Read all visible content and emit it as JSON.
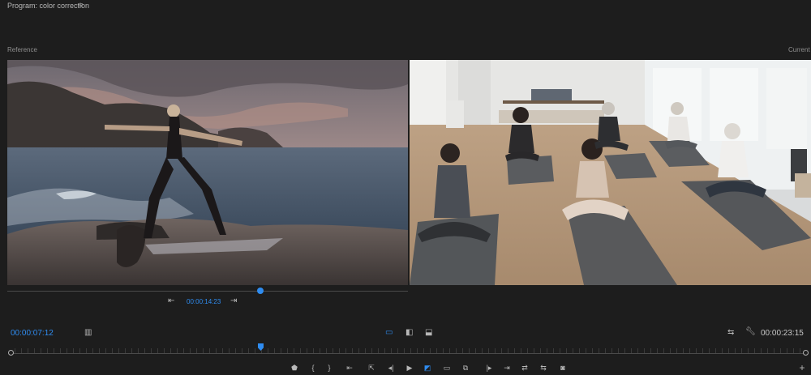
{
  "window": {
    "title": "Program: color correction",
    "menu_icon": "hamburger-menu-icon"
  },
  "labels": {
    "reference": "Reference",
    "current": "Current"
  },
  "reference_scrub": {
    "timecode": "00:00:14:23",
    "position": 0.63
  },
  "playhead_timecode": "00:00:07:12",
  "duration_timecode": "00:00:23:15",
  "timeline": {
    "playhead_position": 0.31
  },
  "accent": "#2f8cf0",
  "icons": {
    "step_back": "step-back-icon",
    "step_forward": "step-forward-icon",
    "settings": "wrench-icon"
  }
}
